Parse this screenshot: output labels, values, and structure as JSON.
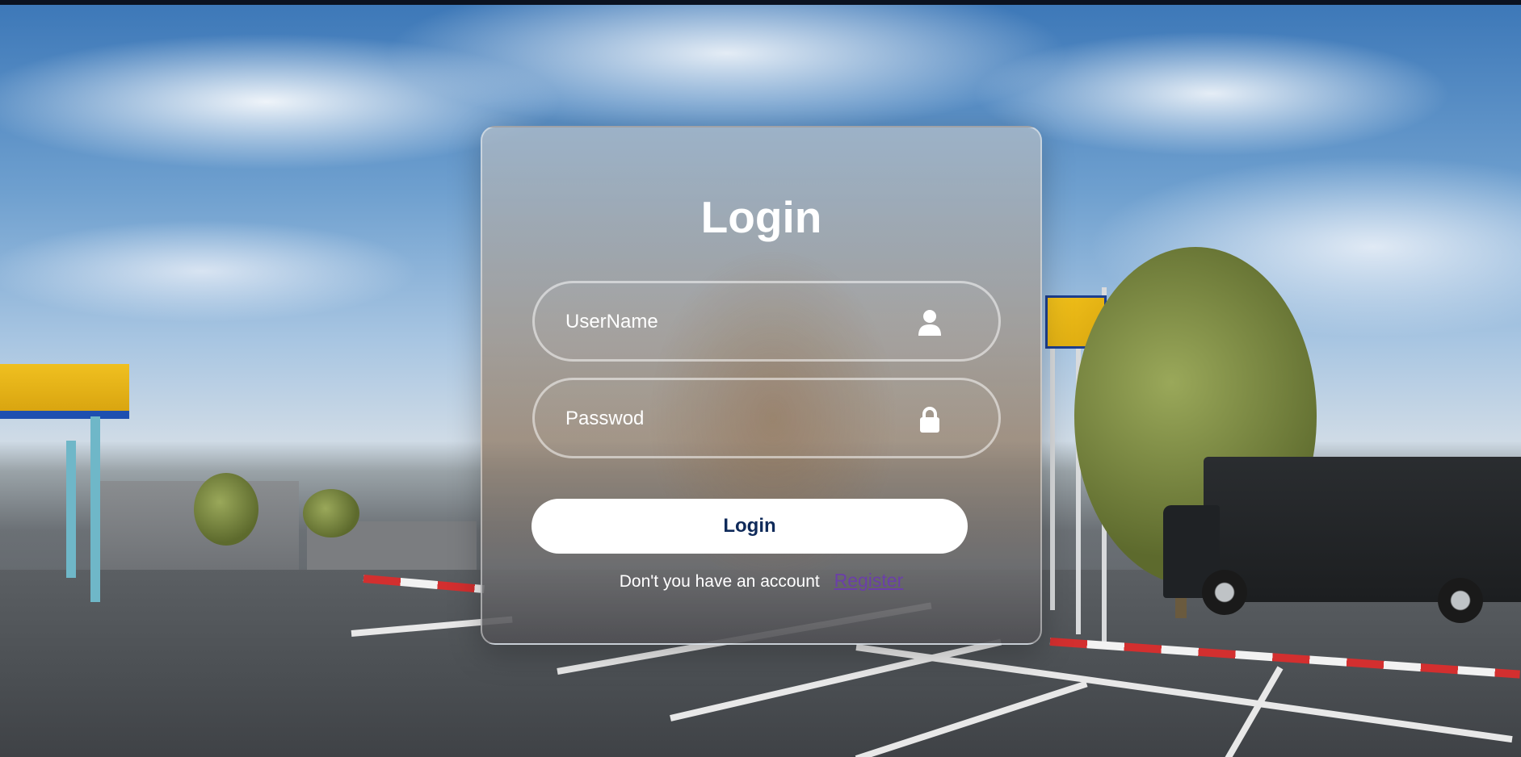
{
  "login_form": {
    "title": "Login",
    "username": {
      "placeholder": "UserName",
      "value": "",
      "icon": "user-icon"
    },
    "password": {
      "placeholder": "Passwod",
      "value": "",
      "icon": "lock-icon"
    },
    "submit_label": "Login",
    "register_prompt": "Don't you have an account",
    "register_link": "Register"
  },
  "colors": {
    "button_background": "#ffffff",
    "button_text": "#0f2a5a",
    "link_visited": "#6b3fa8",
    "text": "#ffffff"
  }
}
